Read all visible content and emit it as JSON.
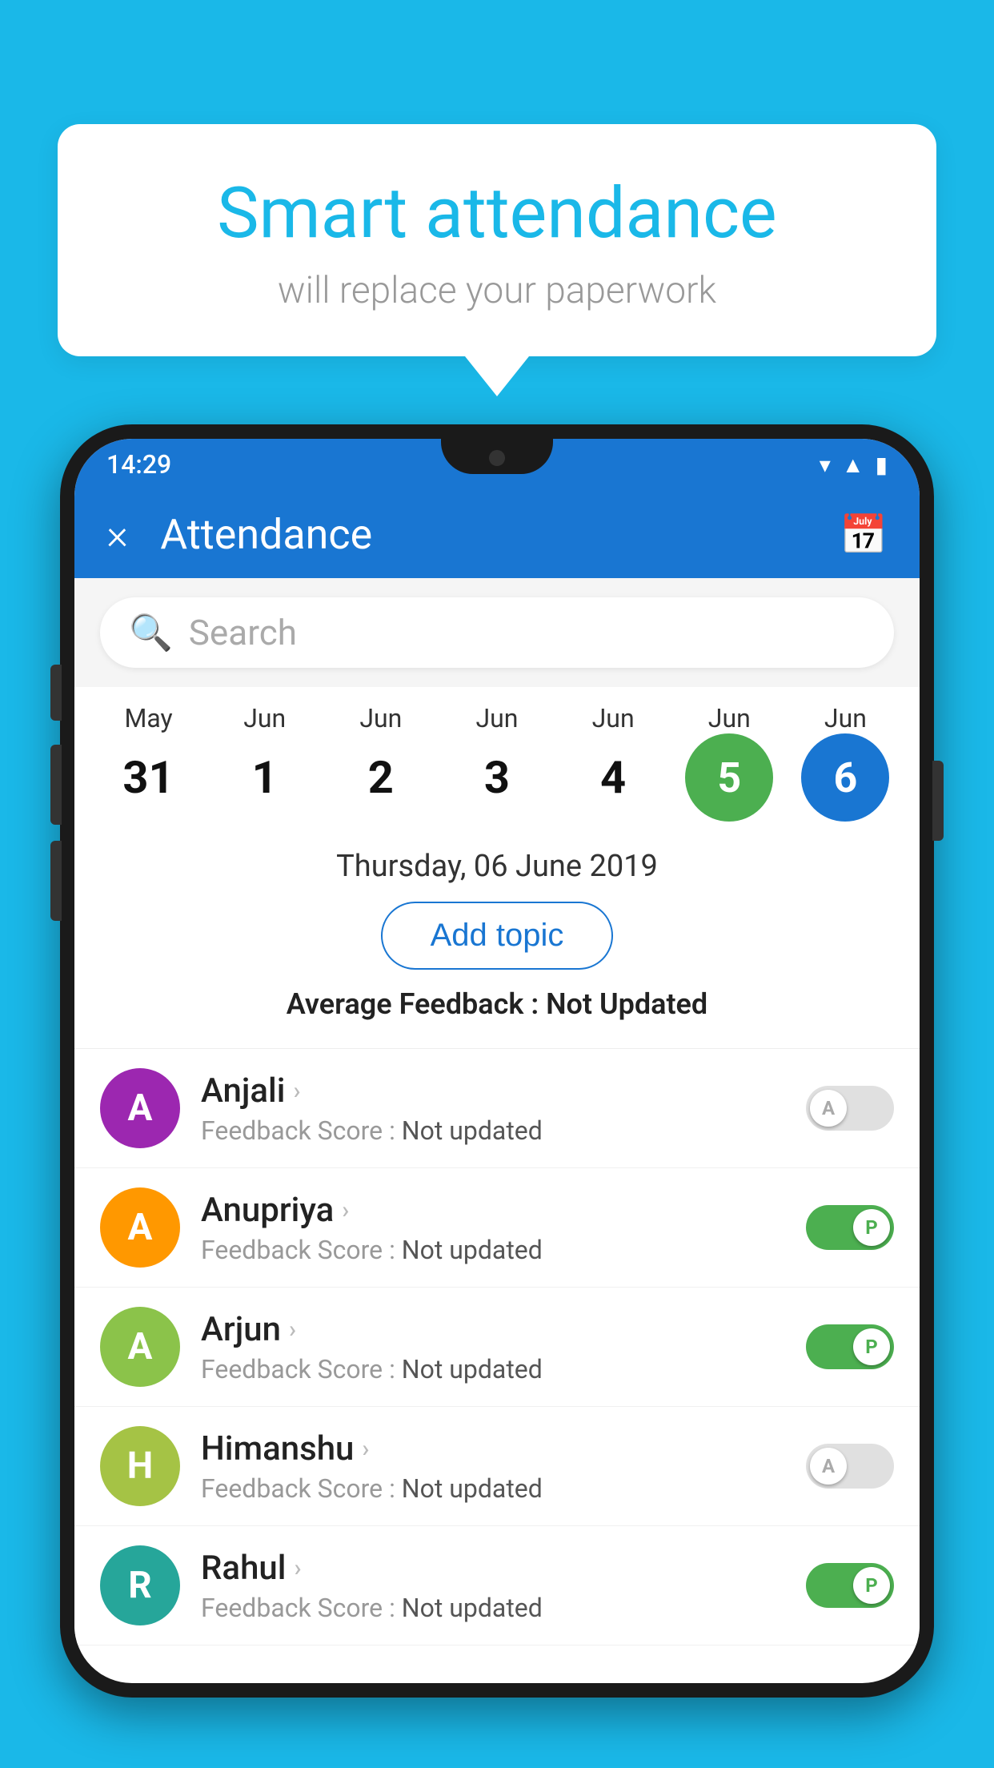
{
  "background_color": "#1ab8e8",
  "speech_bubble": {
    "title": "Smart attendance",
    "subtitle": "will replace your paperwork"
  },
  "status_bar": {
    "time": "14:29"
  },
  "app_header": {
    "title": "Attendance",
    "close_label": "×",
    "calendar_label": "📅"
  },
  "search": {
    "placeholder": "Search"
  },
  "dates": [
    {
      "month": "May",
      "day": "31",
      "state": "normal"
    },
    {
      "month": "Jun",
      "day": "1",
      "state": "normal"
    },
    {
      "month": "Jun",
      "day": "2",
      "state": "normal"
    },
    {
      "month": "Jun",
      "day": "3",
      "state": "normal"
    },
    {
      "month": "Jun",
      "day": "4",
      "state": "normal"
    },
    {
      "month": "Jun",
      "day": "5",
      "state": "today"
    },
    {
      "month": "Jun",
      "day": "6",
      "state": "selected"
    }
  ],
  "selected_date": "Thursday, 06 June 2019",
  "add_topic_label": "Add topic",
  "avg_feedback_label": "Average Feedback :",
  "avg_feedback_value": "Not Updated",
  "students": [
    {
      "name": "Anjali",
      "initial": "A",
      "avatar_color": "purple",
      "feedback_label": "Feedback Score :",
      "feedback_value": "Not updated",
      "toggle": "off",
      "toggle_letter": "A"
    },
    {
      "name": "Anupriya",
      "initial": "A",
      "avatar_color": "orange",
      "feedback_label": "Feedback Score :",
      "feedback_value": "Not updated",
      "toggle": "on",
      "toggle_letter": "P"
    },
    {
      "name": "Arjun",
      "initial": "A",
      "avatar_color": "green",
      "feedback_label": "Feedback Score :",
      "feedback_value": "Not updated",
      "toggle": "on",
      "toggle_letter": "P"
    },
    {
      "name": "Himanshu",
      "initial": "H",
      "avatar_color": "olive",
      "feedback_label": "Feedback Score :",
      "feedback_value": "Not updated",
      "toggle": "off",
      "toggle_letter": "A"
    },
    {
      "name": "Rahul",
      "initial": "R",
      "avatar_color": "teal",
      "feedback_label": "Feedback Score :",
      "feedback_value": "Not updated",
      "toggle": "on",
      "toggle_letter": "P"
    }
  ]
}
